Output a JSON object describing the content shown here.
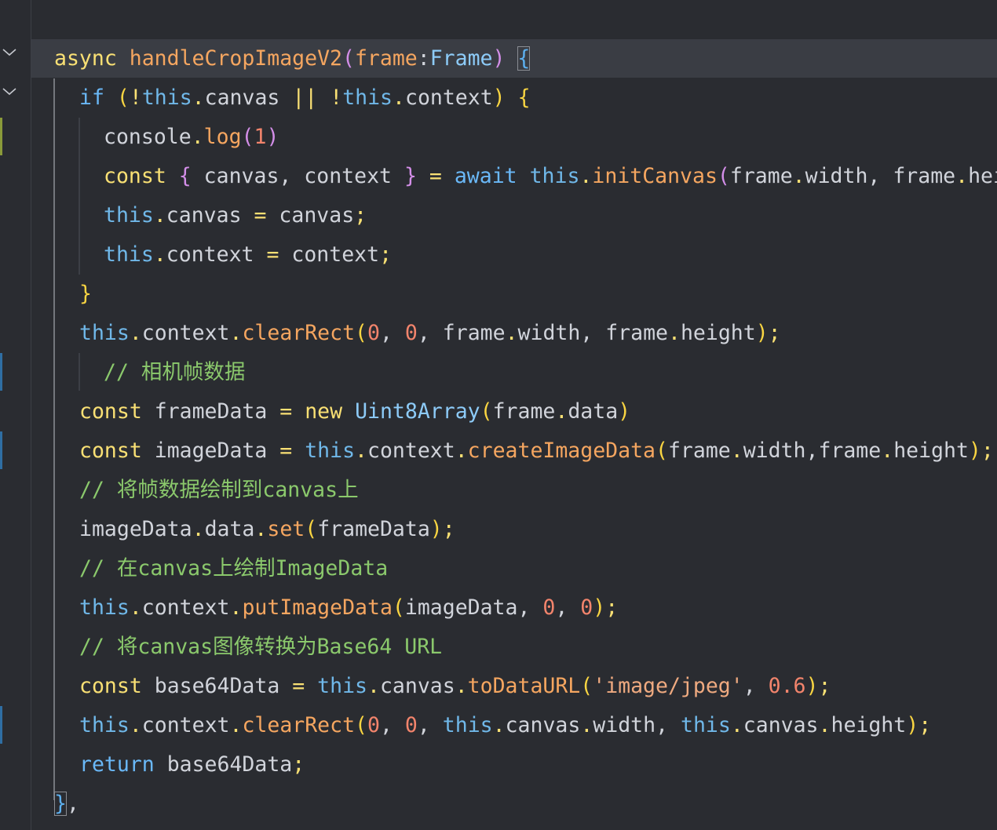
{
  "editor": {
    "lines": [
      {
        "indent": 0,
        "tokens": [
          [
            "async",
            "kw"
          ],
          [
            " ",
            "plain"
          ],
          [
            "handleCropImageV2",
            "fn"
          ],
          [
            "(",
            "paren2"
          ],
          [
            "frame",
            "param"
          ],
          [
            ":",
            "plain"
          ],
          [
            "Frame",
            "type"
          ],
          [
            ")",
            "paren2"
          ],
          [
            " ",
            "plain"
          ],
          [
            "{",
            "paren2b"
          ]
        ]
      },
      {
        "indent": 1,
        "tokens": [
          [
            "if",
            "kw-blue"
          ],
          [
            " ",
            "plain"
          ],
          [
            "(",
            "paren1"
          ],
          [
            "!",
            "op"
          ],
          [
            "this",
            "this-kw"
          ],
          [
            ".",
            "op"
          ],
          [
            "canvas",
            "plain"
          ],
          [
            " ",
            "plain"
          ],
          [
            "||",
            "op"
          ],
          [
            " ",
            "plain"
          ],
          [
            "!",
            "op"
          ],
          [
            "this",
            "this-kw"
          ],
          [
            ".",
            "op"
          ],
          [
            "context",
            "plain"
          ],
          [
            ")",
            "paren1"
          ],
          [
            " ",
            "plain"
          ],
          [
            "{",
            "paren1"
          ]
        ]
      },
      {
        "indent": 2,
        "tokens": [
          [
            "console",
            "plain"
          ],
          [
            ".",
            "op"
          ],
          [
            "log",
            "fn"
          ],
          [
            "(",
            "paren2"
          ],
          [
            "1",
            "num"
          ],
          [
            ")",
            "paren2"
          ]
        ]
      },
      {
        "indent": 2,
        "tokens": [
          [
            "const",
            "kw"
          ],
          [
            " ",
            "plain"
          ],
          [
            "{",
            "paren2"
          ],
          [
            " canvas, context ",
            "plain"
          ],
          [
            "}",
            "paren2"
          ],
          [
            " ",
            "plain"
          ],
          [
            "=",
            "op"
          ],
          [
            " ",
            "plain"
          ],
          [
            "await",
            "kw-blue"
          ],
          [
            " ",
            "plain"
          ],
          [
            "this",
            "this-kw"
          ],
          [
            ".",
            "op"
          ],
          [
            "initCanvas",
            "fn"
          ],
          [
            "(",
            "paren2"
          ],
          [
            "frame",
            "plain"
          ],
          [
            ".",
            "op"
          ],
          [
            "width",
            "plain"
          ],
          [
            ", ",
            "plain"
          ],
          [
            "frame",
            "plain"
          ],
          [
            ".",
            "op"
          ],
          [
            "height",
            "plain"
          ]
        ]
      },
      {
        "indent": 2,
        "tokens": [
          [
            "this",
            "this-kw"
          ],
          [
            ".",
            "op"
          ],
          [
            "canvas",
            "plain"
          ],
          [
            " ",
            "plain"
          ],
          [
            "=",
            "op"
          ],
          [
            " canvas",
            "plain"
          ],
          [
            ";",
            "op"
          ]
        ]
      },
      {
        "indent": 2,
        "tokens": [
          [
            "this",
            "this-kw"
          ],
          [
            ".",
            "op"
          ],
          [
            "context",
            "plain"
          ],
          [
            " ",
            "plain"
          ],
          [
            "=",
            "op"
          ],
          [
            " context",
            "plain"
          ],
          [
            ";",
            "op"
          ]
        ]
      },
      {
        "indent": 1,
        "tokens": [
          [
            "}",
            "paren1"
          ]
        ]
      },
      {
        "indent": 1,
        "tokens": [
          [
            "this",
            "this-kw"
          ],
          [
            ".",
            "op"
          ],
          [
            "context",
            "plain"
          ],
          [
            ".",
            "op"
          ],
          [
            "clearRect",
            "fn"
          ],
          [
            "(",
            "paren1"
          ],
          [
            "0",
            "num"
          ],
          [
            ", ",
            "plain"
          ],
          [
            "0",
            "num"
          ],
          [
            ", frame",
            "plain"
          ],
          [
            ".",
            "op"
          ],
          [
            "width, frame",
            "plain"
          ],
          [
            ".",
            "op"
          ],
          [
            "height",
            "plain"
          ],
          [
            ")",
            "paren1"
          ],
          [
            ";",
            "op"
          ]
        ]
      },
      {
        "indent": 2,
        "tokens": [
          [
            "// 相机帧数据",
            "cmt"
          ]
        ]
      },
      {
        "indent": 1,
        "tokens": [
          [
            "const",
            "kw"
          ],
          [
            " frameData ",
            "plain"
          ],
          [
            "=",
            "op"
          ],
          [
            " ",
            "plain"
          ],
          [
            "new",
            "kw"
          ],
          [
            " ",
            "plain"
          ],
          [
            "Uint8Array",
            "type"
          ],
          [
            "(",
            "paren1"
          ],
          [
            "frame",
            "plain"
          ],
          [
            ".",
            "op"
          ],
          [
            "data",
            "plain"
          ],
          [
            ")",
            "paren1"
          ]
        ]
      },
      {
        "indent": 1,
        "tokens": [
          [
            "const",
            "kw"
          ],
          [
            " imageData ",
            "plain"
          ],
          [
            "=",
            "op"
          ],
          [
            " ",
            "plain"
          ],
          [
            "this",
            "this-kw"
          ],
          [
            ".",
            "op"
          ],
          [
            "context",
            "plain"
          ],
          [
            ".",
            "op"
          ],
          [
            "createImageData",
            "fn"
          ],
          [
            "(",
            "paren1"
          ],
          [
            "frame",
            "plain"
          ],
          [
            ".",
            "op"
          ],
          [
            "width,frame",
            "plain"
          ],
          [
            ".",
            "op"
          ],
          [
            "height",
            "plain"
          ],
          [
            ")",
            "paren1"
          ],
          [
            ";",
            "op"
          ]
        ]
      },
      {
        "indent": 1,
        "tokens": [
          [
            "// 将帧数据绘制到canvas上",
            "cmt"
          ]
        ]
      },
      {
        "indent": 1,
        "tokens": [
          [
            "imageData",
            "plain"
          ],
          [
            ".",
            "op"
          ],
          [
            "data",
            "plain"
          ],
          [
            ".",
            "op"
          ],
          [
            "set",
            "fn"
          ],
          [
            "(",
            "paren1"
          ],
          [
            "frameData",
            "plain"
          ],
          [
            ")",
            "paren1"
          ],
          [
            ";",
            "op"
          ]
        ]
      },
      {
        "indent": 1,
        "tokens": [
          [
            "// 在canvas上绘制ImageData",
            "cmt"
          ]
        ]
      },
      {
        "indent": 1,
        "tokens": [
          [
            "this",
            "this-kw"
          ],
          [
            ".",
            "op"
          ],
          [
            "context",
            "plain"
          ],
          [
            ".",
            "op"
          ],
          [
            "putImageData",
            "fn"
          ],
          [
            "(",
            "paren1"
          ],
          [
            "imageData, ",
            "plain"
          ],
          [
            "0",
            "num"
          ],
          [
            ", ",
            "plain"
          ],
          [
            "0",
            "num"
          ],
          [
            ")",
            "paren1"
          ],
          [
            ";",
            "op"
          ]
        ]
      },
      {
        "indent": 1,
        "tokens": [
          [
            "// 将canvas图像转换为Base64 URL",
            "cmt"
          ]
        ]
      },
      {
        "indent": 1,
        "tokens": [
          [
            "const",
            "kw"
          ],
          [
            " base64Data ",
            "plain"
          ],
          [
            "=",
            "op"
          ],
          [
            " ",
            "plain"
          ],
          [
            "this",
            "this-kw"
          ],
          [
            ".",
            "op"
          ],
          [
            "canvas",
            "plain"
          ],
          [
            ".",
            "op"
          ],
          [
            "toDataURL",
            "fn"
          ],
          [
            "(",
            "paren1"
          ],
          [
            "'image/jpeg'",
            "str"
          ],
          [
            ", ",
            "plain"
          ],
          [
            "0.6",
            "num"
          ],
          [
            ")",
            "paren1"
          ],
          [
            ";",
            "op"
          ]
        ]
      },
      {
        "indent": 1,
        "tokens": [
          [
            "this",
            "this-kw"
          ],
          [
            ".",
            "op"
          ],
          [
            "context",
            "plain"
          ],
          [
            ".",
            "op"
          ],
          [
            "clearRect",
            "fn"
          ],
          [
            "(",
            "paren1"
          ],
          [
            "0",
            "num"
          ],
          [
            ", ",
            "plain"
          ],
          [
            "0",
            "num"
          ],
          [
            ", ",
            "plain"
          ],
          [
            "this",
            "this-kw"
          ],
          [
            ".",
            "op"
          ],
          [
            "canvas",
            "plain"
          ],
          [
            ".",
            "op"
          ],
          [
            "width, ",
            "plain"
          ],
          [
            "this",
            "this-kw"
          ],
          [
            ".",
            "op"
          ],
          [
            "canvas",
            "plain"
          ],
          [
            ".",
            "op"
          ],
          [
            "height",
            "plain"
          ],
          [
            ")",
            "paren1"
          ],
          [
            ";",
            "op"
          ]
        ]
      },
      {
        "indent": 1,
        "tokens": [
          [
            "return",
            "kw-blue"
          ],
          [
            " base64Data",
            "plain"
          ],
          [
            ";",
            "op"
          ]
        ]
      },
      {
        "indent": 0,
        "tokens": [
          [
            "}",
            "paren2b"
          ],
          [
            ",",
            "plain"
          ]
        ]
      }
    ]
  },
  "gutter": {
    "fold_icons": [
      "chevron-down-icon",
      "chevron-down-icon"
    ]
  },
  "colors": {
    "background": "#2a2c31",
    "current_line": "#3a3d44",
    "keyword": "#f9e074",
    "function": "#f5a660",
    "comment": "#8bc96c",
    "number": "#f2846c",
    "this": "#70b8e9"
  }
}
